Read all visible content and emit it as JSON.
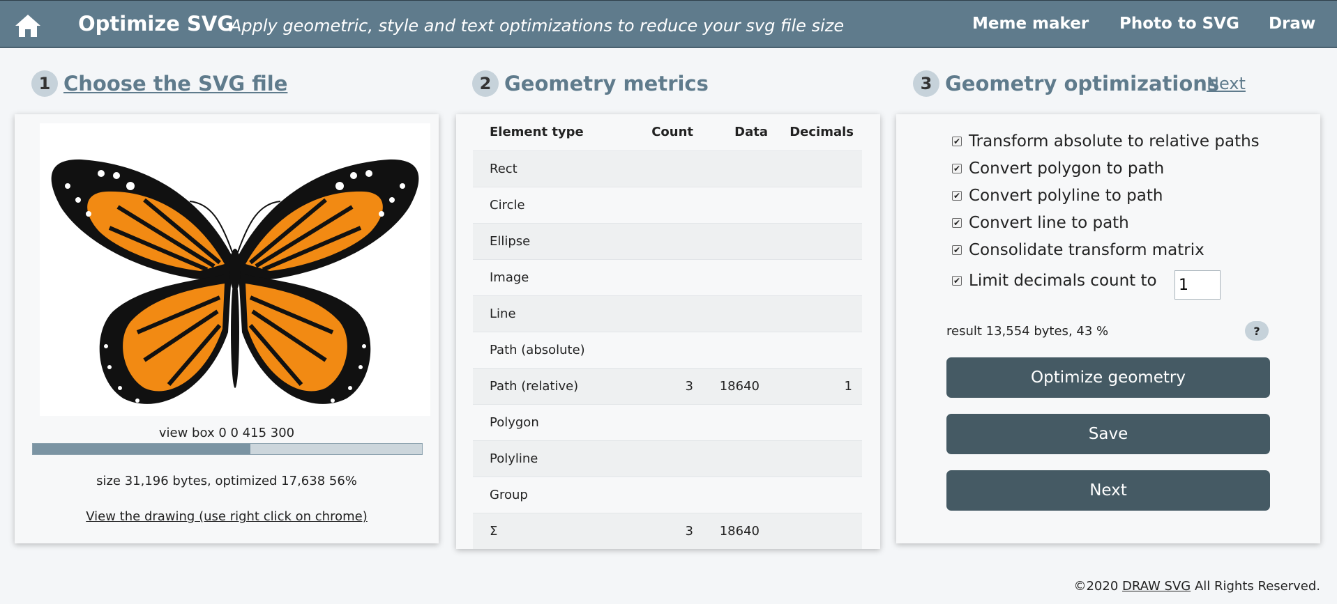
{
  "header": {
    "home_icon": "home-icon",
    "title": "Optimize SVG",
    "tagline": "Apply geometric, style and text optimizations to reduce your svg file size",
    "nav": [
      "Meme maker",
      "Photo to SVG",
      "Draw"
    ]
  },
  "steps": [
    {
      "num": "1",
      "label": "Choose the SVG file"
    },
    {
      "num": "2",
      "label": "Geometry metrics"
    },
    {
      "num": "3",
      "label": "Geometry optimizations"
    }
  ],
  "next_link": "Next",
  "file_panel": {
    "viewbox": "view box 0 0 415 300",
    "progress_fraction": 0.56,
    "size_text": "size 31,196 bytes, optimized 17,638 56%",
    "view_link": "View the drawing (use right click on chrome)"
  },
  "metrics": {
    "headers": [
      "Element type",
      "Count",
      "Data",
      "Decimals"
    ],
    "rows": [
      {
        "type": "Rect",
        "count": "",
        "data": "",
        "decimals": ""
      },
      {
        "type": "Circle",
        "count": "",
        "data": "",
        "decimals": ""
      },
      {
        "type": "Ellipse",
        "count": "",
        "data": "",
        "decimals": ""
      },
      {
        "type": "Image",
        "count": "",
        "data": "",
        "decimals": ""
      },
      {
        "type": "Line",
        "count": "",
        "data": "",
        "decimals": ""
      },
      {
        "type": "Path (absolute)",
        "count": "",
        "data": "",
        "decimals": ""
      },
      {
        "type": "Path (relative)",
        "count": "3",
        "data": "18640",
        "decimals": "1"
      },
      {
        "type": "Polygon",
        "count": "",
        "data": "",
        "decimals": ""
      },
      {
        "type": "Polyline",
        "count": "",
        "data": "",
        "decimals": ""
      },
      {
        "type": "Group",
        "count": "",
        "data": "",
        "decimals": ""
      },
      {
        "type": "Σ",
        "count": "3",
        "data": "18640",
        "decimals": ""
      }
    ]
  },
  "optimizations": {
    "options": [
      {
        "label": "Transform absolute to relative paths",
        "checked": true
      },
      {
        "label": "Convert polygon to path",
        "checked": true
      },
      {
        "label": "Convert polyline to path",
        "checked": true
      },
      {
        "label": "Convert line to path",
        "checked": true
      },
      {
        "label": "Consolidate transform matrix",
        "checked": true
      },
      {
        "label": "Limit decimals count to",
        "checked": true
      }
    ],
    "decimals_value": "1",
    "result": "result 13,554 bytes, 43 %",
    "help": "?",
    "buttons": {
      "optimize": "Optimize geometry",
      "save": "Save",
      "next": "Next"
    }
  },
  "footer": {
    "prefix": "©2020",
    "link": "DRAW SVG",
    "suffix": "All Rights Reserved."
  },
  "colors": {
    "header": "#5f7b8c",
    "button": "#455a64",
    "orange": "#f28a13"
  }
}
